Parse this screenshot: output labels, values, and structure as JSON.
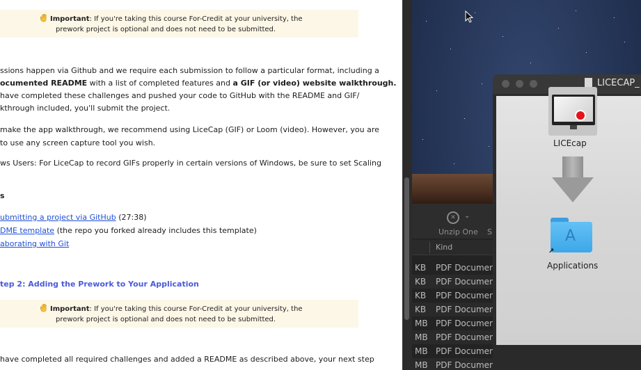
{
  "document": {
    "callout_top": {
      "bold": "Important",
      "text1": ": If you're taking this course For-Credit at your university, the",
      "text2": "prework project is optional and does not need to be submitted."
    },
    "para1": {
      "l1": "ssions happen via Github and we require each submission to follow a particular format, including a",
      "l2_a": "ocumented README",
      "l2_b": " with a list of completed features and ",
      "l2_c": "a GIF (or video) website walkthrough.",
      "l3": "have completed these challenges and pushed your code to GitHub with the README and GIF/",
      "l4": "kthrough included, you'll submit the project."
    },
    "para2": {
      "l1": "make the app walkthrough, we recommend using LiceCap (GIF) or Loom (video). However, you are",
      "l2": "to use any screen capture tool you wish."
    },
    "para3": {
      "l1": "ws Users: For LiceCap to record GIFs properly in certain versions of Windows, be sure to set Scaling"
    },
    "heading_fragment": "s",
    "links": {
      "item1_link": "ubmitting a project via GitHub",
      "item1_rest": " (27:38)",
      "item2_link": "DME template",
      "item2_rest": " (the repo you forked already includes this template)",
      "item3_link": "aborating with Git"
    },
    "step_heading": "tep 2: Adding the Prework to Your Application",
    "callout_bottom": {
      "bold": "Important",
      "text1": ": If you're taking this course For-Credit at your university, the",
      "text2": "prework project is optional and does not need to be submitted."
    },
    "para4": {
      "l1": "have completed all required challenges and added a README as described above, your next step"
    }
  },
  "finder": {
    "toolbar": {
      "unzip_label": "Unzip One",
      "partial_label": "S"
    },
    "column_header": "Kind",
    "rows": [
      {
        "unit": "KB",
        "kind": "PDF Documen"
      },
      {
        "unit": "KB",
        "kind": "PDF Documen"
      },
      {
        "unit": "KB",
        "kind": "PDF Documen"
      },
      {
        "unit": "KB",
        "kind": "PDF Documen"
      },
      {
        "unit": "MB",
        "kind": "PDF Documen"
      },
      {
        "unit": "MB",
        "kind": "PDF Documen"
      },
      {
        "unit": "MB",
        "kind": "PDF Documen"
      },
      {
        "unit": "MB",
        "kind": "PDF Document"
      }
    ]
  },
  "dmg_window": {
    "title": "LICECAP_",
    "app_label": "LICEcap",
    "folder_label": "Applications"
  },
  "colors": {
    "callout_bg": "#fdf7e7",
    "link": "#1f4fd6",
    "step_heading": "#4a5bd8",
    "record_dot": "#e3141b",
    "folder": "#3da7e8"
  },
  "icons": [
    "wave-hand-icon",
    "unzip-icon",
    "chevron-down-icon",
    "document-icon",
    "licecap-app-icon",
    "arrow-down-icon",
    "applications-folder-icon",
    "alias-arrow-icon",
    "mouse-cursor-icon"
  ]
}
